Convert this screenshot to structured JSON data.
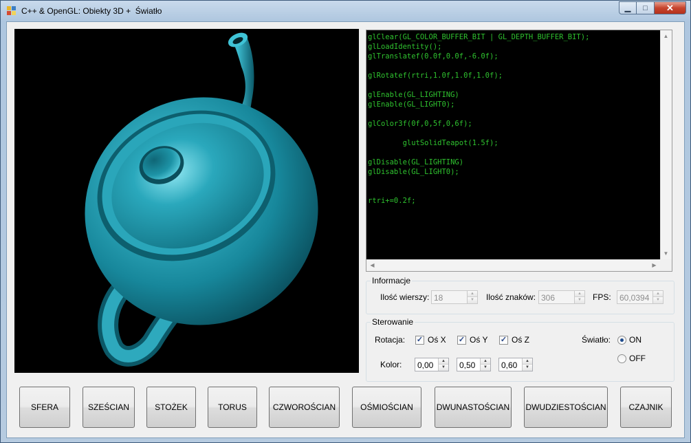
{
  "window": {
    "title": "C++ & OpenGL: Obiekty 3D +  Światło",
    "controls": {
      "minimize": "▁",
      "maximize": "□",
      "close": "✕"
    }
  },
  "viewport": {
    "object": "teapot",
    "object_color": "#1c93a6",
    "background": "#000000"
  },
  "code": {
    "lines": [
      "glClear(GL_COLOR_BUFFER_BIT | GL_DEPTH_BUFFER_BIT);",
      "glLoadIdentity();",
      "glTranslatef(0.0f,0.0f,-6.0f);",
      "",
      "glRotatef(rtri,1.0f,1.0f,1.0f);",
      "",
      "glEnable(GL_LIGHTING)",
      "glEnable(GL_LIGHT0);",
      "",
      "glColor3f(0f,0,5f,0,6f);",
      "",
      "        glutSolidTeapot(1.5f);",
      "",
      "glDisable(GL_LIGHTING)",
      "glDisable(GL_LIGHT0);",
      "",
      "",
      "rtri+=0.2f;"
    ],
    "text_color": "#2fc22f"
  },
  "info": {
    "legend": "Informacje",
    "rows_label": "Ilość wierszy:",
    "rows_value": "18",
    "chars_label": "Ilość znaków:",
    "chars_value": "306",
    "fps_label": "FPS:",
    "fps_value": "60,0394"
  },
  "control": {
    "legend": "Sterowanie",
    "rotation_label": "Rotacja:",
    "axis_x": {
      "label": "Oś X",
      "checked": true
    },
    "axis_y": {
      "label": "Oś Y",
      "checked": true
    },
    "axis_z": {
      "label": "Oś Z",
      "checked": true
    },
    "light_label": "Światło:",
    "light_on": "ON",
    "light_off": "OFF",
    "light_selected": "ON",
    "color_label": "Kolor:",
    "color_r": "0,00",
    "color_g": "0,50",
    "color_b": "0,60"
  },
  "buttons": [
    "SFERA",
    "SZEŚCIAN",
    "STOŻEK",
    "TORUS",
    "CZWOROŚCIAN",
    "OŚMIOŚCIAN",
    "DWUNASTOŚCIAN",
    "DWUDZIESTOŚCIAN",
    "CZAJNIK"
  ]
}
